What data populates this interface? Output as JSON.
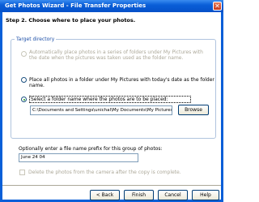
{
  "window": {
    "title": "Get Photos Wizard - File Transfer Properties"
  },
  "step": {
    "heading": "Step 2. Choose where to place your photos."
  },
  "target": {
    "group_label": "Target directory",
    "option_series": "Automatically place photos in a series of folders under My Pictures with the date when the pictures was taken used as the folder name.",
    "option_date": "Place all photos in a folder under My Pictures with today's date as the folder name.",
    "option_select": "Select a folder name where the photos are to be placed:",
    "path_value": "C:\\Documents and Settings\\unichal\\My Documents\\My Pictures\\car",
    "browse_label": "Browse"
  },
  "prefix": {
    "label": "Optionally enter a file name prefix for this group of photos:",
    "value": "June 24 04"
  },
  "delete_option": "Delete the photos from the camera after the copy is complete.",
  "buttons": {
    "back": "< Back",
    "finish": "Finish",
    "cancel": "Cancel",
    "help": "Help"
  }
}
